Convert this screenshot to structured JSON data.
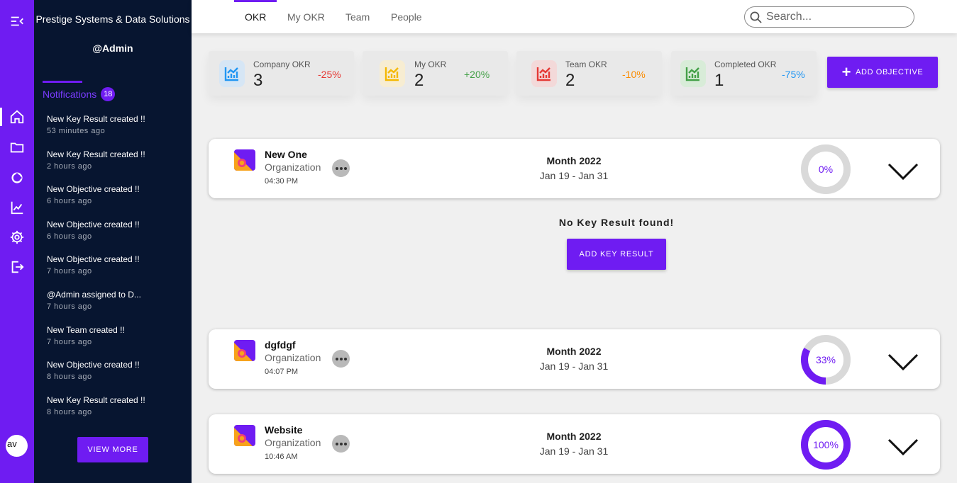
{
  "rail": {
    "icons": [
      "menu-collapse-icon",
      "home-icon",
      "folder-icon",
      "pie-chart-icon",
      "chart-icon",
      "settings-icon",
      "logout-icon"
    ],
    "avatar_label": "av"
  },
  "sidebar": {
    "org_name": "Prestige Systems & Data Solutions",
    "user": "@Admin",
    "notifications_label": "Notifications",
    "notifications_count": "18",
    "notifications": [
      {
        "text": "New Key Result created !!",
        "time": "53 minutes ago"
      },
      {
        "text": "New Key Result created !!",
        "time": "2 hours ago"
      },
      {
        "text": "New Objective created !!",
        "time": "6 hours ago"
      },
      {
        "text": "New Objective created !!",
        "time": "6 hours ago"
      },
      {
        "text": "New Objective created !!",
        "time": "7 hours ago"
      },
      {
        "text": "@Admin assigned to D...",
        "time": "7 hours ago"
      },
      {
        "text": "New Team created !!",
        "time": "7 hours ago"
      },
      {
        "text": "New Objective created !!",
        "time": "8 hours ago"
      },
      {
        "text": "New Key Result created !!",
        "time": "8 hours ago"
      }
    ],
    "view_more_label": "VIEW MORE"
  },
  "topbar": {
    "tabs": [
      {
        "label": "OKR",
        "active": true
      },
      {
        "label": "My OKR",
        "active": false
      },
      {
        "label": "Team",
        "active": false
      },
      {
        "label": "People",
        "active": false
      }
    ],
    "search_placeholder": "Search..."
  },
  "stats": [
    {
      "label": "Company OKR",
      "value": "3",
      "change": "-25%",
      "change_color": "#e53935",
      "icon_bg": "#d6e6f5",
      "icon_color": "#2196f3"
    },
    {
      "label": "My OKR",
      "value": "2",
      "change": "+20%",
      "change_color": "#43a047",
      "icon_bg": "#f7edd2",
      "icon_color": "#f5b800"
    },
    {
      "label": "Team OKR",
      "value": "2",
      "change": "-10%",
      "change_color": "#fb8c00",
      "icon_bg": "#f3d9d9",
      "icon_color": "#e53935"
    },
    {
      "label": "Completed OKR",
      "value": "1",
      "change": "-75%",
      "change_color": "#2196f3",
      "icon_bg": "#d8ecd8",
      "icon_color": "#43a047"
    }
  ],
  "add_objective_label": "ADD OBJECTIVE",
  "objectives": [
    {
      "name": "New One",
      "type": "Organization",
      "time": "04:30 PM",
      "period": "Month 2022",
      "dates": "Jan 19 - Jan 31",
      "progress_label": "0%",
      "progress": 0
    },
    {
      "name": "dgfdgf",
      "type": "Organization",
      "time": "04:07 PM",
      "period": "Month 2022",
      "dates": "Jan 19 - Jan 31",
      "progress_label": "33%",
      "progress": 0.33
    },
    {
      "name": "Website",
      "type": "Organization",
      "time": "10:46 AM",
      "period": "Month 2022",
      "dates": "Jan 19 - Jan 31",
      "progress_label": "100%",
      "progress": 1
    }
  ],
  "empty_key_result": "No Key Result found!",
  "add_key_result_label": "ADD KEY RESULT",
  "colors": {
    "accent": "#6f1cf2",
    "sidebar": "#071530",
    "ring_track": "#d9d9d9"
  }
}
